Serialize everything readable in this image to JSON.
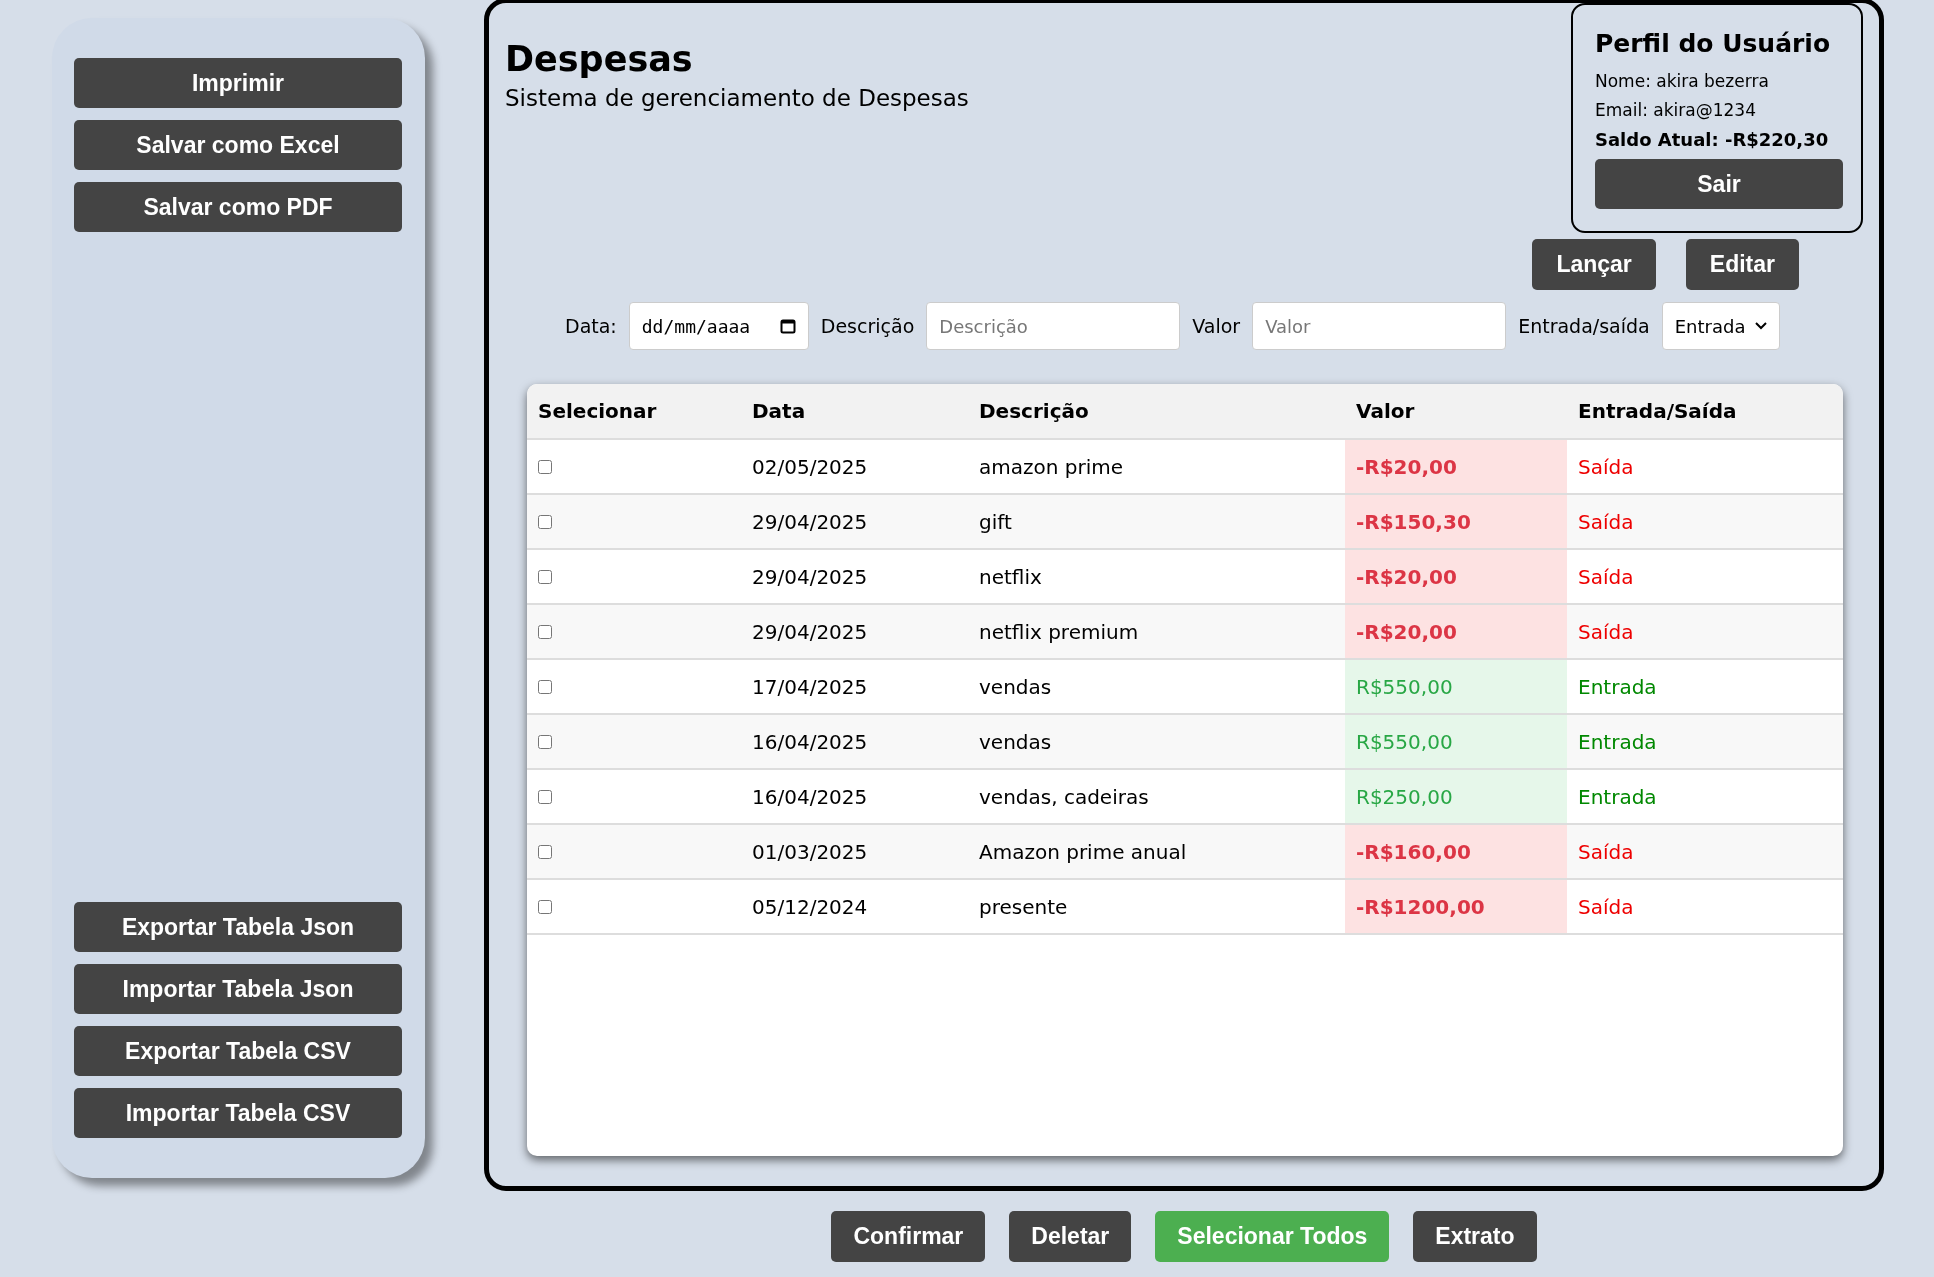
{
  "sidebar": {
    "top_buttons": [
      "Imprimir",
      "Salvar como Excel",
      "Salvar como PDF"
    ],
    "bottom_buttons": [
      "Exportar Tabela Json",
      "Importar Tabela Json",
      "Exportar Tabela CSV",
      "Importar Tabela CSV"
    ]
  },
  "header": {
    "title": "Despesas",
    "subtitle": "Sistema de gerenciamento de Despesas"
  },
  "profile": {
    "title": "Perfil do Usuário",
    "name": "Nome: akira bezerra",
    "email": "Email: akira@1234",
    "balance": "Saldo Atual: -R$220,30",
    "button": "Sair"
  },
  "actions": [
    "Lançar",
    "Editar"
  ],
  "form": {
    "date_label": "Data:",
    "date_placeholder": "dd/mm/aaaa",
    "description_label": "Descrição",
    "description_placeholder": "Descrição",
    "value_label": "Valor",
    "value_placeholder": "Valor",
    "type_label": "Entrada/saída",
    "type_value": "Entrada"
  },
  "table": {
    "columns": [
      "Selecionar",
      "Data",
      "Descrição",
      "Valor",
      "Entrada/Saída"
    ],
    "rows": [
      {
        "checked": false,
        "date": "02/05/2025",
        "description": "amazon prime",
        "value": "-R$20,00",
        "type": "Saída",
        "kind": "out"
      },
      {
        "checked": false,
        "date": "29/04/2025",
        "description": "gift",
        "value": "-R$150,30",
        "type": "Saída",
        "kind": "out"
      },
      {
        "checked": false,
        "date": "29/04/2025",
        "description": "netflix",
        "value": "-R$20,00",
        "type": "Saída",
        "kind": "out"
      },
      {
        "checked": false,
        "date": "29/04/2025",
        "description": "netflix premium",
        "value": "-R$20,00",
        "type": "Saída",
        "kind": "out"
      },
      {
        "checked": false,
        "date": "17/04/2025",
        "description": "vendas",
        "value": "R$550,00",
        "type": "Entrada",
        "kind": "in"
      },
      {
        "checked": false,
        "date": "16/04/2025",
        "description": "vendas",
        "value": "R$550,00",
        "type": "Entrada",
        "kind": "in"
      },
      {
        "checked": false,
        "date": "16/04/2025",
        "description": "vendas, cadeiras",
        "value": "R$250,00",
        "type": "Entrada",
        "kind": "in"
      },
      {
        "checked": false,
        "date": "01/03/2025",
        "description": "Amazon prime anual",
        "value": "-R$160,00",
        "type": "Saída",
        "kind": "out"
      },
      {
        "checked": false,
        "date": "05/12/2024",
        "description": "presente",
        "value": "-R$1200,00",
        "type": "Saída",
        "kind": "out"
      }
    ]
  },
  "bottom_buttons": [
    {
      "label": "Confirmar",
      "kind": "dark"
    },
    {
      "label": "Deletar",
      "kind": "dark"
    },
    {
      "label": "Selecionar Todos",
      "kind": "green"
    },
    {
      "label": "Extrato",
      "kind": "dark"
    }
  ]
}
